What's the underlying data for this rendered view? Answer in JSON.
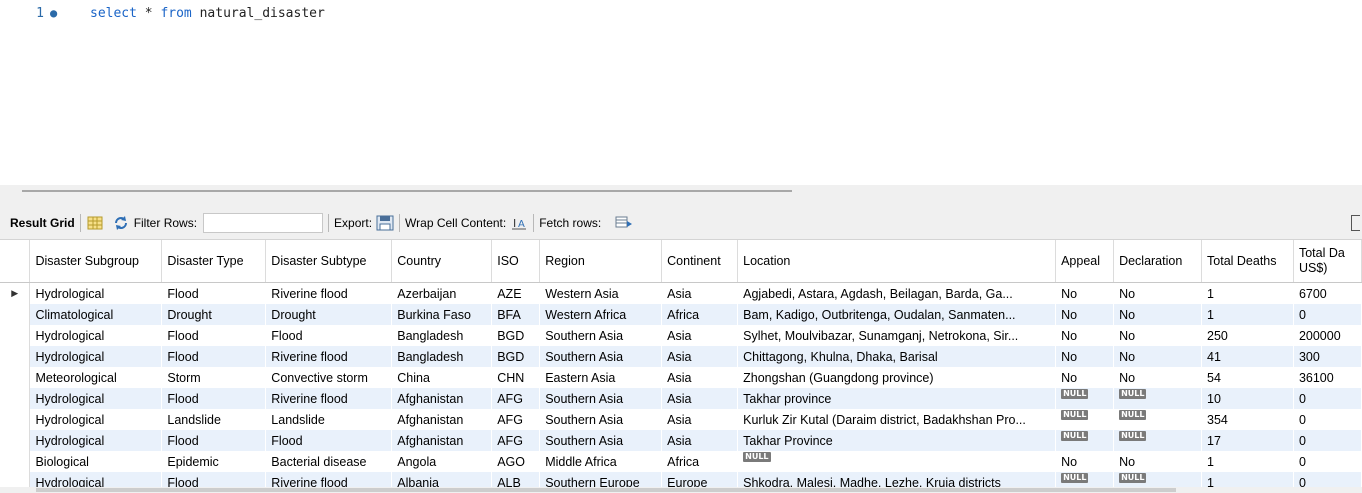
{
  "editor": {
    "line_number": "1",
    "line_marker": "●",
    "sql": {
      "kw1": "select",
      "star": " * ",
      "kw2": "from",
      "table": " natural_disaster"
    }
  },
  "toolbar": {
    "result_grid": "Result Grid",
    "filter_rows": "Filter Rows:",
    "filter_value": "",
    "export": "Export:",
    "wrap_cell": "Wrap Cell Content:",
    "fetch_rows": "Fetch rows:"
  },
  "grid": {
    "columns": [
      "Disaster Subgroup",
      "Disaster Type",
      "Disaster Subtype",
      "Country",
      "ISO",
      "Region",
      "Continent",
      "Location",
      "Appeal",
      "Declaration",
      "Total Deaths",
      "Total Da US$)"
    ],
    "rows": [
      [
        "Hydrological",
        "Flood",
        "Riverine flood",
        "Azerbaijan",
        "AZE",
        "Western Asia",
        "Asia",
        "Agjabedi, Astara, Agdash, Beilagan, Barda, Ga...",
        "No",
        "No",
        "1",
        "6700"
      ],
      [
        "Climatological",
        "Drought",
        "Drought",
        "Burkina Faso",
        "BFA",
        "Western Africa",
        "Africa",
        "Bam, Kadigo, Outbritenga, Oudalan, Sanmaten...",
        "No",
        "No",
        "1",
        "0"
      ],
      [
        "Hydrological",
        "Flood",
        "Flood",
        "Bangladesh",
        "BGD",
        "Southern Asia",
        "Asia",
        "Sylhet, Moulvibazar, Sunamganj, Netrokona, Sir...",
        "No",
        "No",
        "250",
        "200000"
      ],
      [
        "Hydrological",
        "Flood",
        "Riverine flood",
        "Bangladesh",
        "BGD",
        "Southern Asia",
        "Asia",
        "Chittagong, Khulna, Dhaka, Barisal",
        "No",
        "No",
        "41",
        "300"
      ],
      [
        "Meteorological",
        "Storm",
        "Convective storm",
        "China",
        "CHN",
        "Eastern Asia",
        "Asia",
        "Zhongshan (Guangdong province)",
        "No",
        "No",
        "54",
        "36100"
      ],
      [
        "Hydrological",
        "Flood",
        "Riverine flood",
        "Afghanistan",
        "AFG",
        "Southern Asia",
        "Asia",
        "Takhar province",
        "NULL",
        "NULL",
        "10",
        "0"
      ],
      [
        "Hydrological",
        "Landslide",
        "Landslide",
        "Afghanistan",
        "AFG",
        "Southern Asia",
        "Asia",
        "Kurluk Zir Kutal (Daraim district, Badakhshan Pro...",
        "NULL",
        "NULL",
        "354",
        "0"
      ],
      [
        "Hydrological",
        "Flood",
        "Flood",
        "Afghanistan",
        "AFG",
        "Southern Asia",
        "Asia",
        "Takhar Province",
        "NULL",
        "NULL",
        "17",
        "0"
      ],
      [
        "Biological",
        "Epidemic",
        "Bacterial disease",
        "Angola",
        "AGO",
        "Middle Africa",
        "Africa",
        "NULL",
        "No",
        "No",
        "1",
        "0"
      ],
      [
        "Hydrological",
        "Flood",
        "Riverine flood",
        "Albania",
        "ALB",
        "Southern Europe",
        "Europe",
        "Shkodra, Malesi, Madhe, Lezhe, Kruja districts",
        "NULL",
        "NULL",
        "1",
        "0"
      ]
    ],
    "current_row_marker": "▶",
    "null_label": "NULL"
  }
}
